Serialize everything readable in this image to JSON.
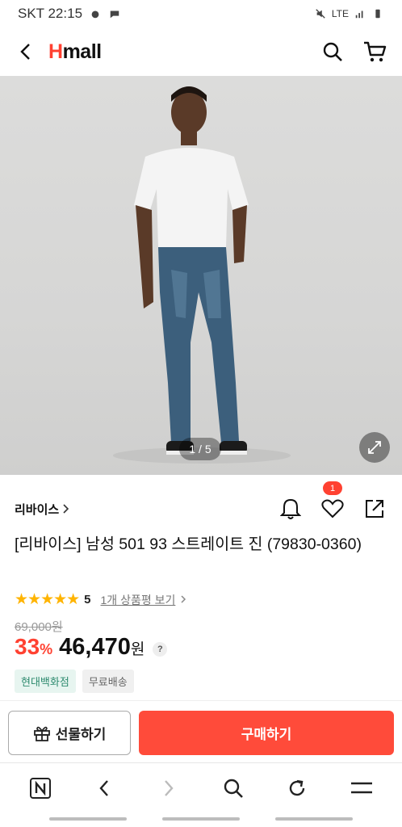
{
  "status_bar": {
    "carrier_time": "SKT 22:15",
    "network": "LTE"
  },
  "header": {
    "logo_h": "H",
    "logo_rest": "mall"
  },
  "gallery": {
    "pager": "1 / 5"
  },
  "product": {
    "brand": "리바이스",
    "wish_count": "1",
    "title": "[리바이스] 남성 501 93 스트레이트 진 (79830-0360)",
    "stars": "★★★★★",
    "rating": "5",
    "review_link": "1개 상품평 보기",
    "original_price": "69,000원",
    "discount_value": "33",
    "discount_unit": "%",
    "price": "46,470",
    "price_unit": "원",
    "help": "?",
    "tags": [
      "현대백화점",
      "무료배송"
    ]
  },
  "actions": {
    "gift_label": "선물하기",
    "buy_label": "구매하기"
  },
  "colors": {
    "brand_red": "#ff4131",
    "star": "#ffb400",
    "dept_tag": "#2e8b6f"
  },
  "icons": {
    "header": [
      "back-icon",
      "search-icon",
      "cart-icon"
    ],
    "product": [
      "bell-icon",
      "heart-icon",
      "share-icon"
    ],
    "browser_nav": [
      "naver-home-icon",
      "back-icon",
      "forward-icon",
      "search-icon",
      "refresh-icon",
      "menu-icon"
    ]
  }
}
